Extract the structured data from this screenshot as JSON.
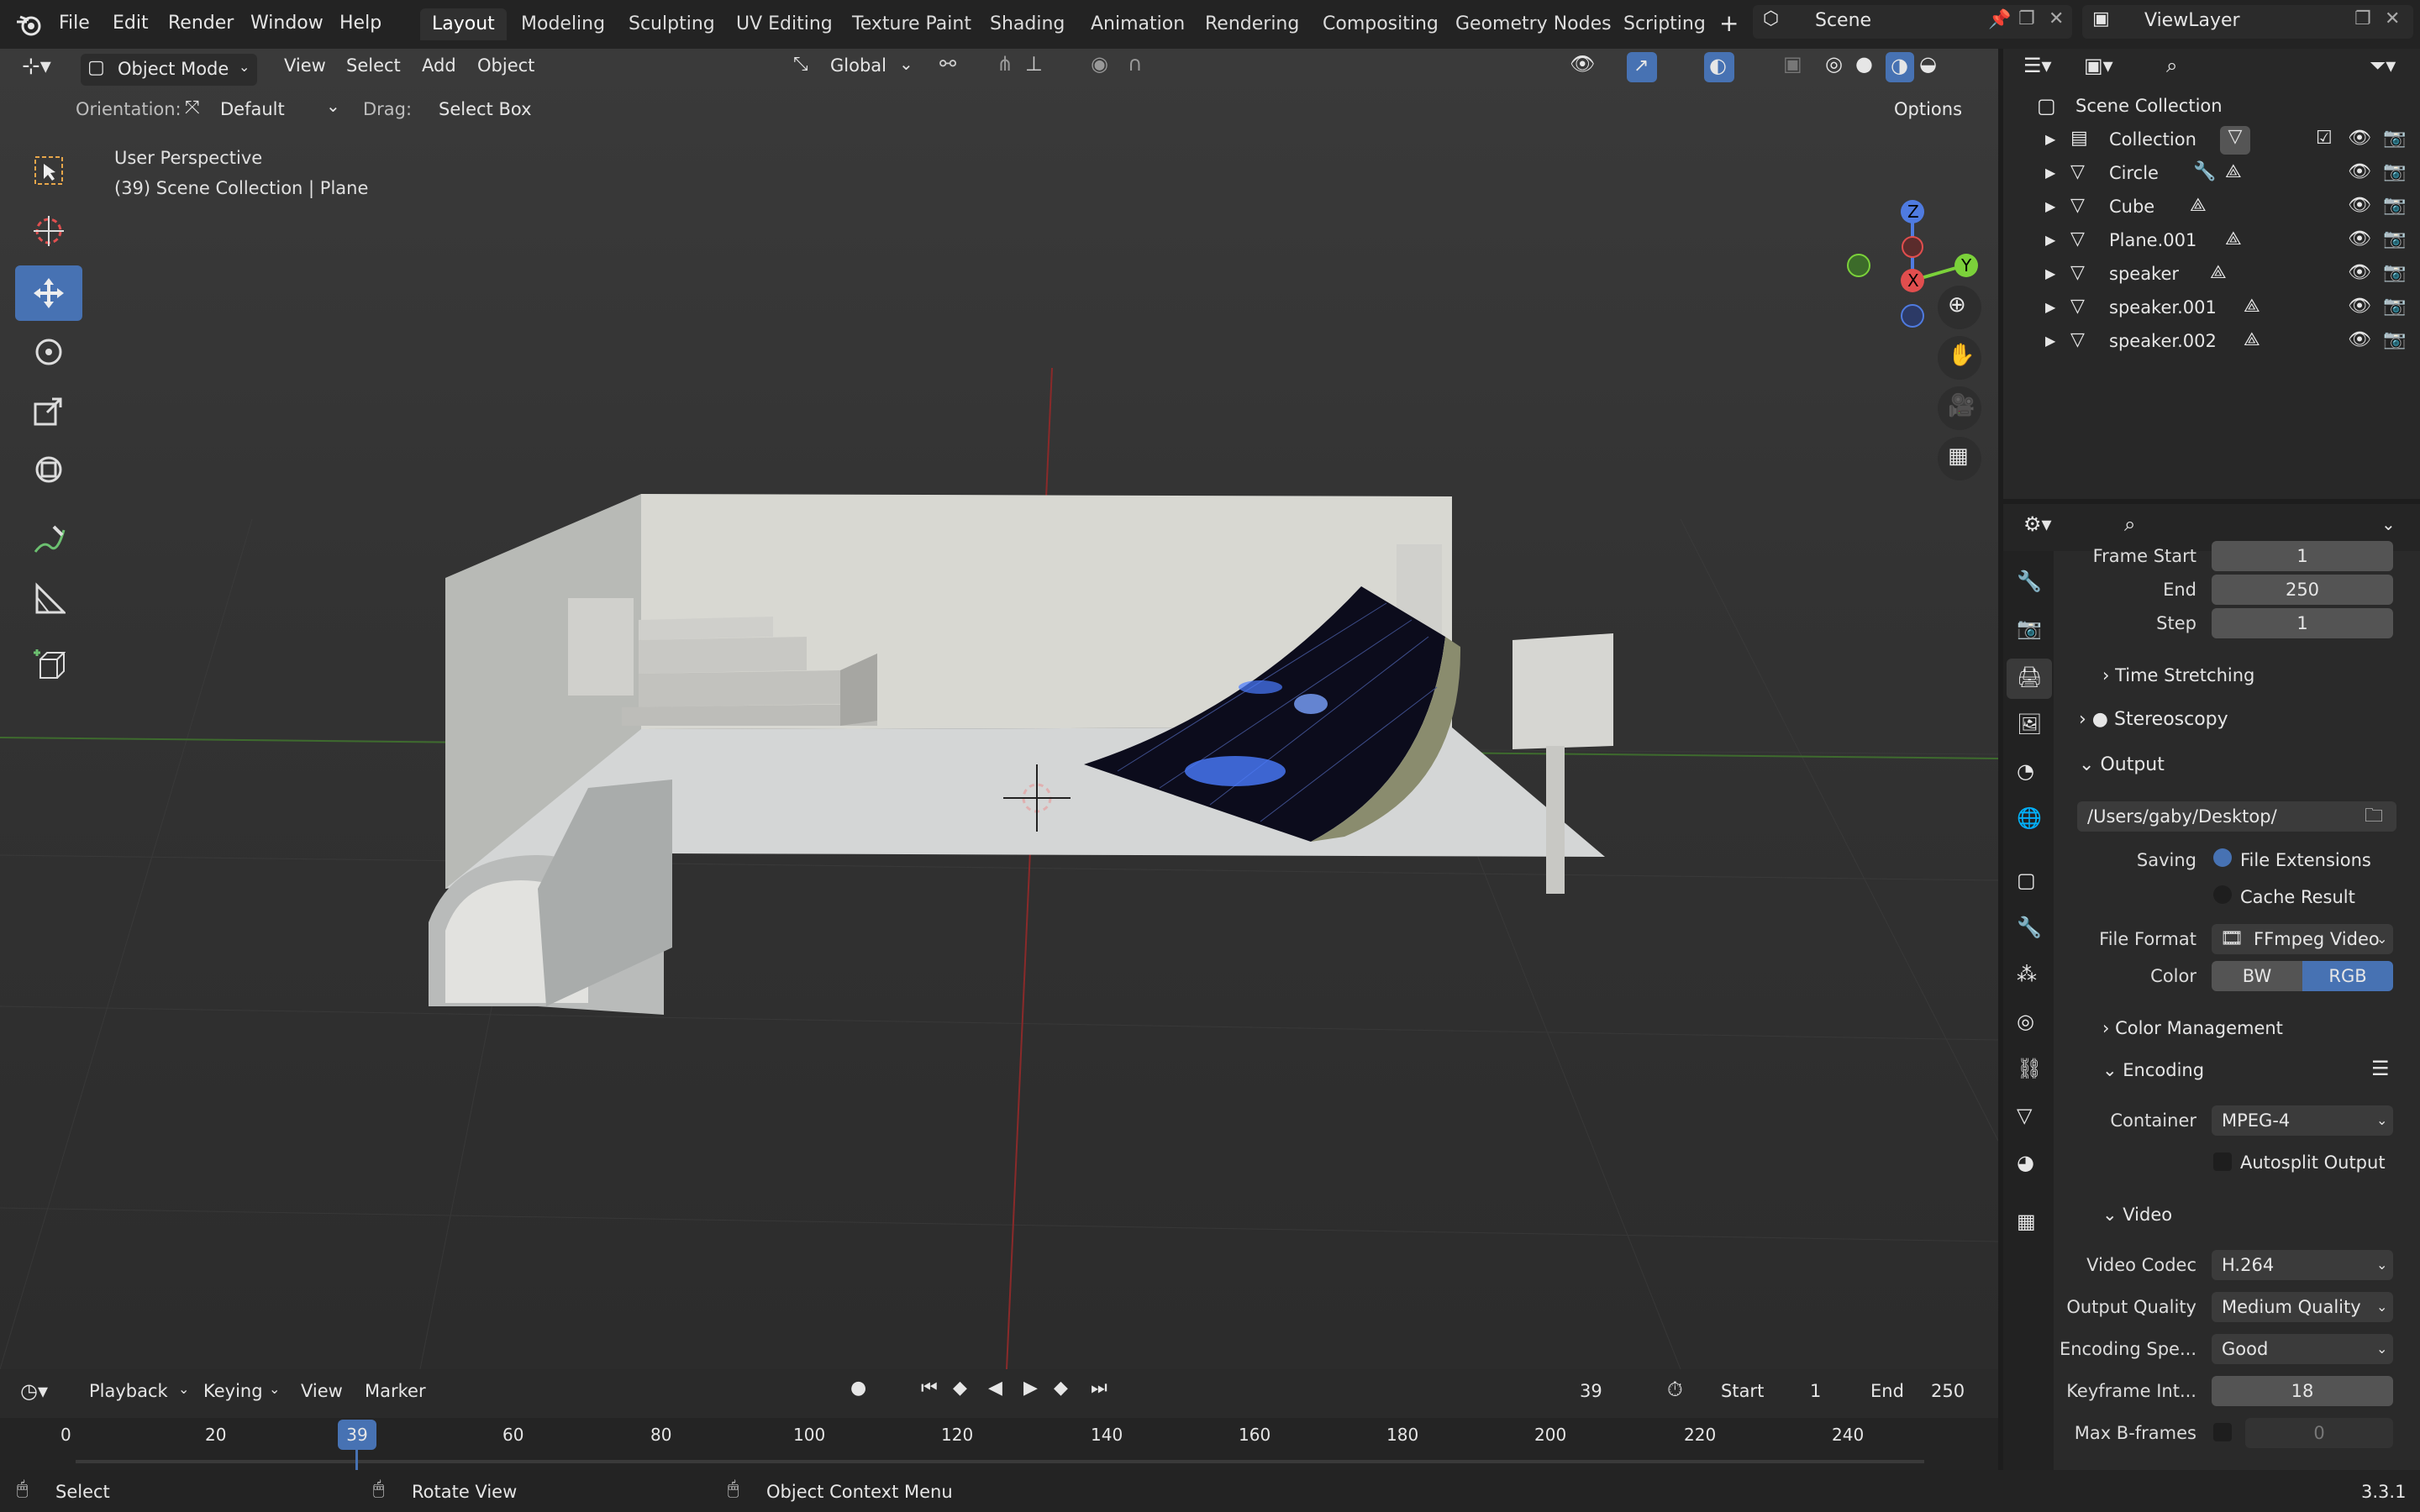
{
  "menu": {
    "items": [
      "File",
      "Edit",
      "Render",
      "Window",
      "Help"
    ]
  },
  "workspaces": [
    "Layout",
    "Modeling",
    "Sculpting",
    "UV Editing",
    "Texture Paint",
    "Shading",
    "Animation",
    "Rendering",
    "Compositing",
    "Geometry Nodes",
    "Scripting"
  ],
  "scene": {
    "name": "Scene",
    "view_layer": "ViewLayer"
  },
  "viewport_header": {
    "mode": "Object Mode",
    "menus": [
      "View",
      "Select",
      "Add",
      "Object"
    ],
    "transform_orientation": "Global",
    "orientation_label": "Orientation:",
    "orientation_value": "Default",
    "drag_label": "Drag:",
    "drag_value": "Select Box",
    "options_label": "Options"
  },
  "viewport_overlay": {
    "perspective": "User Perspective",
    "context": "(39) Scene Collection | Plane"
  },
  "gizmo": {
    "z": "Z",
    "y": "Y",
    "x": "X"
  },
  "outliner": {
    "root": "Scene Collection",
    "items": [
      {
        "name": "Collection",
        "icon": "collection-icon"
      },
      {
        "name": "Circle",
        "icon": "mesh-icon"
      },
      {
        "name": "Cube",
        "icon": "mesh-icon"
      },
      {
        "name": "Plane.001",
        "icon": "mesh-icon"
      },
      {
        "name": "speaker",
        "icon": "mesh-icon"
      },
      {
        "name": "speaker.001",
        "icon": "mesh-icon"
      },
      {
        "name": "speaker.002",
        "icon": "mesh-icon"
      }
    ]
  },
  "properties": {
    "frame_start_label": "Frame Start",
    "frame_start": "1",
    "end_label": "End",
    "end": "250",
    "step_label": "Step",
    "step": "1",
    "time_stretching": "Time Stretching",
    "stereoscopy": "Stereoscopy",
    "output": "Output",
    "output_path": "/Users/gaby/Desktop/",
    "saving_label": "Saving",
    "file_extensions": "File Extensions",
    "cache_result": "Cache Result",
    "file_format_label": "File Format",
    "file_format": "FFmpeg Video",
    "color_label": "Color",
    "color_bw": "BW",
    "color_rgb": "RGB",
    "color_management": "Color Management",
    "encoding": "Encoding",
    "container_label": "Container",
    "container": "MPEG-4",
    "autosplit": "Autosplit Output",
    "video": "Video",
    "video_codec_label": "Video Codec",
    "video_codec": "H.264",
    "output_quality_label": "Output Quality",
    "output_quality": "Medium Quality",
    "encoding_speed_label": "Encoding Spe...",
    "encoding_speed": "Good",
    "keyframe_label": "Keyframe Int...",
    "keyframe": "18",
    "max_bframes_label": "Max B-frames",
    "max_bframes": "0"
  },
  "timeline": {
    "menus": [
      "Playback",
      "Keying",
      "View",
      "Marker"
    ],
    "current_frame": "39",
    "start_label": "Start",
    "start": "1",
    "end_label": "End",
    "end": "250",
    "ticks": [
      "0",
      "20",
      "39",
      "60",
      "80",
      "100",
      "120",
      "140",
      "160",
      "180",
      "200",
      "220",
      "240"
    ]
  },
  "statusbar": {
    "select": "Select",
    "rotate": "Rotate View",
    "context_menu": "Object Context Menu",
    "version": "3.3.1"
  },
  "colors": {
    "accent": "#4772b3",
    "axis_x": "#e14e4e",
    "axis_y": "#7bd13a",
    "axis_z": "#4f7be0"
  }
}
